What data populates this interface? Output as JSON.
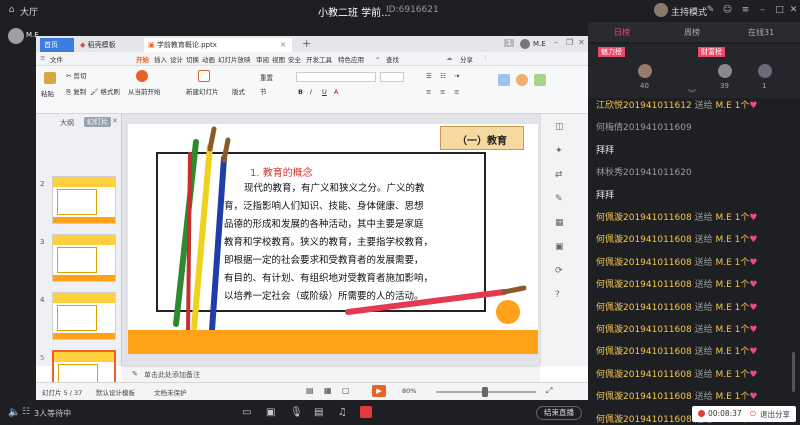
{
  "topbar": {
    "lobby": "大厅",
    "title": "小教二班 学前...",
    "room_id": "ID:6916621",
    "host_mode": "主持模式"
  },
  "wps": {
    "tabs": [
      {
        "label": "首页"
      },
      {
        "label": "稻壳模板"
      },
      {
        "label": "学前教育概论.pptx"
      }
    ],
    "tab_count": "1",
    "user": "M.E",
    "menu": [
      "文件",
      "开始",
      "插入",
      "设计",
      "切换",
      "动画",
      "幻灯片放映",
      "审阅",
      "视图",
      "安全",
      "开发工具",
      "特色应用",
      "查找"
    ],
    "share": "分享",
    "ribbon": {
      "cut": "剪切",
      "copy": "复制",
      "paste": "粘贴",
      "format_painter": "格式刷",
      "play_from_current": "从当前开始",
      "new_slide": "新建幻灯片",
      "layout": "版式",
      "reset": "重置",
      "section": "节"
    },
    "pane_tabs": {
      "outline": "大纲",
      "slides": "幻灯片"
    },
    "thumb_numbers": [
      "2",
      "3",
      "4",
      "5"
    ],
    "slide": {
      "badge": "（一）教育",
      "heading": "1. 教育的概念",
      "lines": [
        "现代的教育，有广义和狭义之分。广义的教",
        "育，泛指影响人们知识、技能、身体健康、思想",
        "品德的形成和发展的各种活动，其中主要是家庭",
        "教育和学校教育。狭义的教育，主要指学校教育，",
        "即根据一定的社会要求和受教育者的发展需要，",
        "有目的、有计划、有组织地对受教育者施加影响，",
        "以培养一定社会（或阶级）所需要的人的活动。"
      ]
    },
    "notes_placeholder": "单击此处添加备注",
    "status": {
      "slide_pos": "幻灯片 5 / 37",
      "design": "默认设计模板",
      "protect": "文档未保护",
      "zoom": "80%"
    }
  },
  "bottombar": {
    "waiting": "3人等待中",
    "end_live": "结束直播"
  },
  "chat": {
    "tabs": [
      "日榜",
      "周榜",
      "在线31"
    ],
    "charm_label": "魅力榜",
    "wealth_label": "财富榜",
    "charm_value": "40",
    "wealth_values": [
      "39",
      "1"
    ],
    "gift_word": "送给",
    "target": "M.E",
    "gift_unit": "1个",
    "lines": [
      {
        "type": "gift",
        "name": "江欣悦201941011612"
      },
      {
        "type": "name",
        "name": "何梅倩201941011609"
      },
      {
        "type": "msg",
        "text": "拜拜"
      },
      {
        "type": "name",
        "name": "林秋秀201941011620"
      },
      {
        "type": "msg",
        "text": "拜拜"
      },
      {
        "type": "gift",
        "name": "何佩漩201941011608"
      },
      {
        "type": "gift",
        "name": "何佩漩201941011608"
      },
      {
        "type": "gift",
        "name": "何佩漩201941011608"
      },
      {
        "type": "gift",
        "name": "何佩漩201941011608"
      },
      {
        "type": "gift",
        "name": "何佩漩201941011608"
      },
      {
        "type": "gift",
        "name": "何佩漩201941011608"
      },
      {
        "type": "gift",
        "name": "何佩漩201941011608"
      },
      {
        "type": "gift",
        "name": "何佩漩201941011608"
      },
      {
        "type": "gift",
        "name": "何佩漩201941011608"
      },
      {
        "type": "gift",
        "name": "何佩漩201941011608"
      }
    ],
    "timer": "00:08:37",
    "exit_share": "退出分享"
  }
}
